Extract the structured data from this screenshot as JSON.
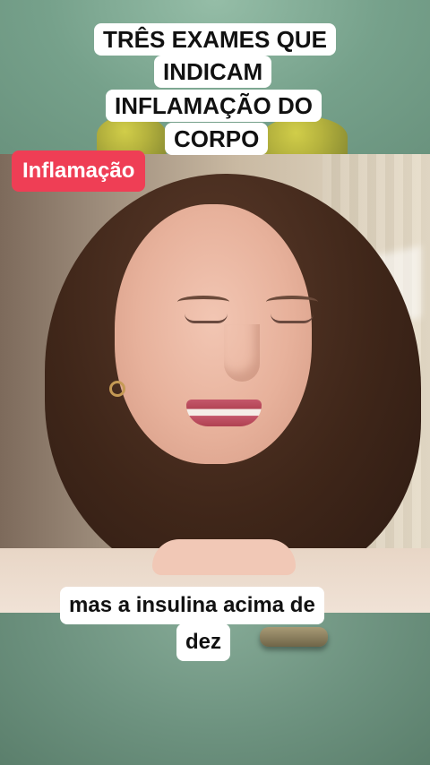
{
  "title_lines": [
    "TRÊS EXAMES QUE",
    "INDICAM",
    "INFLAMAÇÃO DO",
    "CORPO"
  ],
  "tag": "Inflamação",
  "caption_lines": [
    "mas a insulina acima de",
    "dez"
  ],
  "colors": {
    "tag_background": "#ef3e55",
    "overlay_background": "#ffffff",
    "overlay_text": "#111111",
    "background_green": "#7ea792"
  }
}
